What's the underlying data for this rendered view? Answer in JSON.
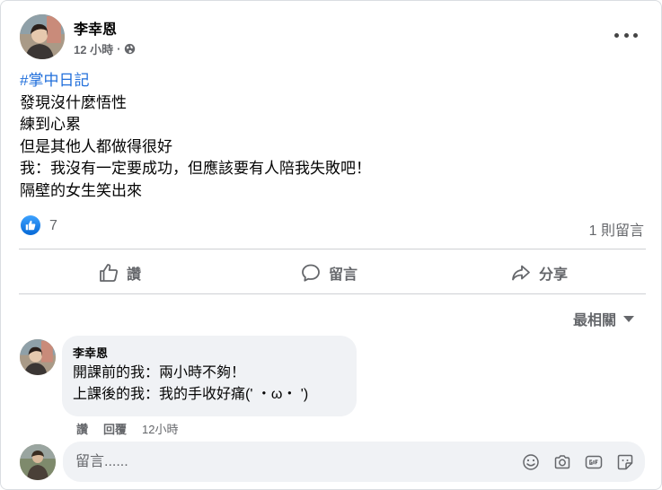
{
  "post": {
    "author": "李幸恩",
    "time": "12 小時",
    "meta_separator": "·",
    "privacy_icon": "globe-icon",
    "hashtag": "#掌中日記",
    "lines": [
      "發現沒什麼悟性",
      "練到心累",
      "但是其他人都做得很好",
      "我：我沒有一定要成功，但應該要有人陪我失敗吧！",
      "隔壁的女生笑出來"
    ],
    "reaction_icon": "like-icon",
    "reactions_count": "7",
    "comments_count": "1 則留言"
  },
  "actions": {
    "like": "讚",
    "comment": "留言",
    "share": "分享"
  },
  "sort": {
    "label": "最相關"
  },
  "comment": {
    "author": "李幸恩",
    "lines": [
      "開課前的我：兩小時不夠！",
      "上課後的我：我的手收好痛(' ・ω・ ')"
    ],
    "like": "讚",
    "reply": "回覆",
    "time": "12小時"
  },
  "composer": {
    "placeholder": "留言......",
    "icons": [
      "emoji-icon",
      "camera-icon",
      "gif-icon",
      "sticker-icon"
    ]
  },
  "colors": {
    "link": "#216fdb",
    "secondary_text": "#65676b",
    "bubble_bg": "#f0f2f5",
    "like_blue": "#0866ff"
  }
}
